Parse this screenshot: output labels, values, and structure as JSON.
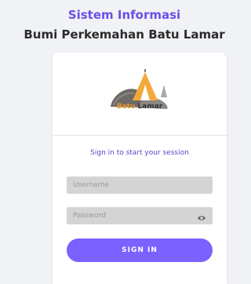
{
  "header": {
    "title": "Sistem Informasi",
    "subtitle": "Bumi Perkemahan Batu Lamar"
  },
  "logo": {
    "word1": "Batu",
    "word2": "Lamar",
    "icon": "tent-on-rocks-logo"
  },
  "login": {
    "message": "Sign in to start your session",
    "username_placeholder": "Username",
    "password_placeholder": "Password",
    "password_toggle_icon": "eye-icon",
    "submit_label": "SIGN IN"
  },
  "colors": {
    "accent": "#7b61ff",
    "title": "#6b4fe6",
    "background": "#f0f2f5"
  }
}
